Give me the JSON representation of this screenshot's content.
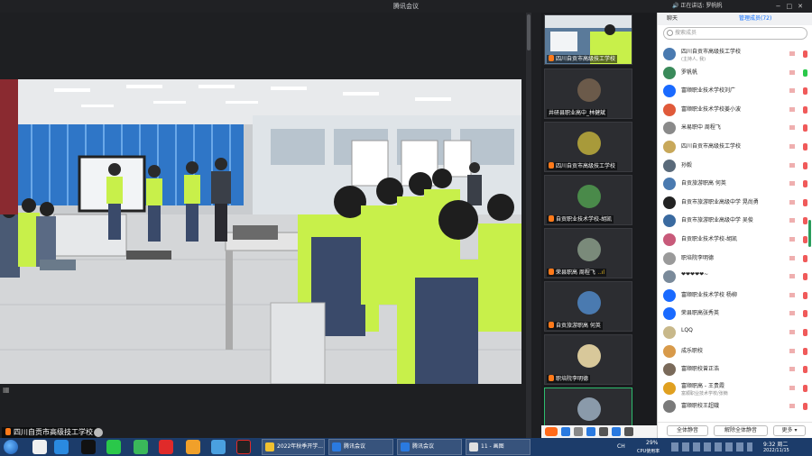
{
  "window": {
    "title": "腾讯会议"
  },
  "main_video": {
    "speaker_label": "四川自贡市高级技工学校"
  },
  "tiles": [
    {
      "name": "四川自贡市高级技工学校",
      "mic": true,
      "active": false,
      "avatar_color": "#3b6b8c"
    },
    {
      "name": "井研县职业高中_林健斌",
      "mic": false,
      "active": false,
      "avatar_color": "#6b5a4a"
    },
    {
      "name": "四川自贡市高级技工学校",
      "mic": true,
      "active": false,
      "avatar_color": "#8a7a2a"
    },
    {
      "name": "自贡职业技术学校-胡凯",
      "mic": true,
      "active": false,
      "avatar_color": "#4a7a4a"
    },
    {
      "name": "荣县职高 周程飞",
      "mic": true,
      "active": false,
      "avatar_color": "#5a7a6a",
      "level": "..ıl"
    },
    {
      "name": "自贡旅游职高 何英",
      "mic": true,
      "active": false,
      "avatar_color": "#4a7ab0"
    },
    {
      "name": "职培院李明德",
      "mic": true,
      "active": false,
      "avatar_color": "#d8c89a"
    },
    {
      "name": "",
      "mic": true,
      "active": true,
      "avatar_color": "#6a7a8a"
    }
  ],
  "panel": {
    "tabs": [
      "聊天",
      "管理成员(72)"
    ],
    "search_placeholder": "搜索成员",
    "participants": [
      {
        "name": "四川自贡市高级技工学校",
        "sub": "(主持人, 我)",
        "color": "#4a7ab0",
        "mic_muted": true
      },
      {
        "name": "罗帆帆",
        "sub": "",
        "color": "#3a8a5a",
        "mic_muted": false
      },
      {
        "name": "富顺职业技术学校刘广",
        "sub": "",
        "color": "#1a6aff",
        "mic_muted": true
      },
      {
        "name": "富顺职业技术学校姜小波",
        "sub": "",
        "color": "#e05a3a",
        "mic_muted": true
      },
      {
        "name": "米易职中 周程飞",
        "sub": "",
        "color": "#8a8a8a",
        "mic_muted": true
      },
      {
        "name": "四川自贡市高级技工学校",
        "sub": "",
        "color": "#c8a85a",
        "mic_muted": true
      },
      {
        "name": "孙毅",
        "sub": "",
        "color": "#5a6a7a",
        "mic_muted": true
      },
      {
        "name": "自贡旅游职高 何英",
        "sub": "",
        "color": "#4a7ab0",
        "mic_muted": true
      },
      {
        "name": "自贡市旅游职业高级中学 晃尚勇",
        "sub": "",
        "color": "#222222",
        "mic_muted": true
      },
      {
        "name": "自贡市旅游职业高级中学 吴俊",
        "sub": "",
        "color": "#3a6aa0",
        "mic_muted": true
      },
      {
        "name": "自贡职业技术学校-胡凯",
        "sub": "",
        "color": "#c85a7a",
        "mic_muted": true
      },
      {
        "name": "职培院李明德",
        "sub": "",
        "color": "#9a9a9a",
        "mic_muted": true
      },
      {
        "name": "❤❤❤❤❤~",
        "sub": "",
        "color": "#7a8a9a",
        "mic_muted": true
      },
      {
        "name": "富顺职业技术学校 杨柳",
        "sub": "",
        "color": "#1a6aff",
        "mic_muted": true
      },
      {
        "name": "荣县职高张秀英",
        "sub": "",
        "color": "#1a6aff",
        "mic_muted": true
      },
      {
        "name": "LQQ",
        "sub": "",
        "color": "#c8b88a",
        "mic_muted": true
      },
      {
        "name": "成乐职校",
        "sub": "",
        "color": "#d89a4a",
        "mic_muted": true
      },
      {
        "name": "富顺职校曾正浩",
        "sub": "",
        "color": "#7a6a5a",
        "mic_muted": true
      },
      {
        "name": "富顺职高 - 王贵霞",
        "sub": "富顺职业技术学校/张楠",
        "color": "#e0a020",
        "mic_muted": true
      },
      {
        "name": "富顺职校王超娥",
        "sub": "",
        "color": "#7a7a7a",
        "mic_muted": true
      }
    ],
    "footer": {
      "mute_all": "全体静音",
      "unmute_all": "解除全体静音",
      "more": "更多 ▾"
    }
  },
  "taskbar": {
    "tasks": [
      "2022年秋季开学...",
      "腾讯会议",
      "腾讯会议",
      "11 - 画图"
    ],
    "cpu": "29%",
    "cpu_label": "CPU使用率",
    "time": "9:32 周二",
    "date": "2022/11/15",
    "lang": "CH"
  },
  "top_notice": "正在讲话: 罗帆帆"
}
